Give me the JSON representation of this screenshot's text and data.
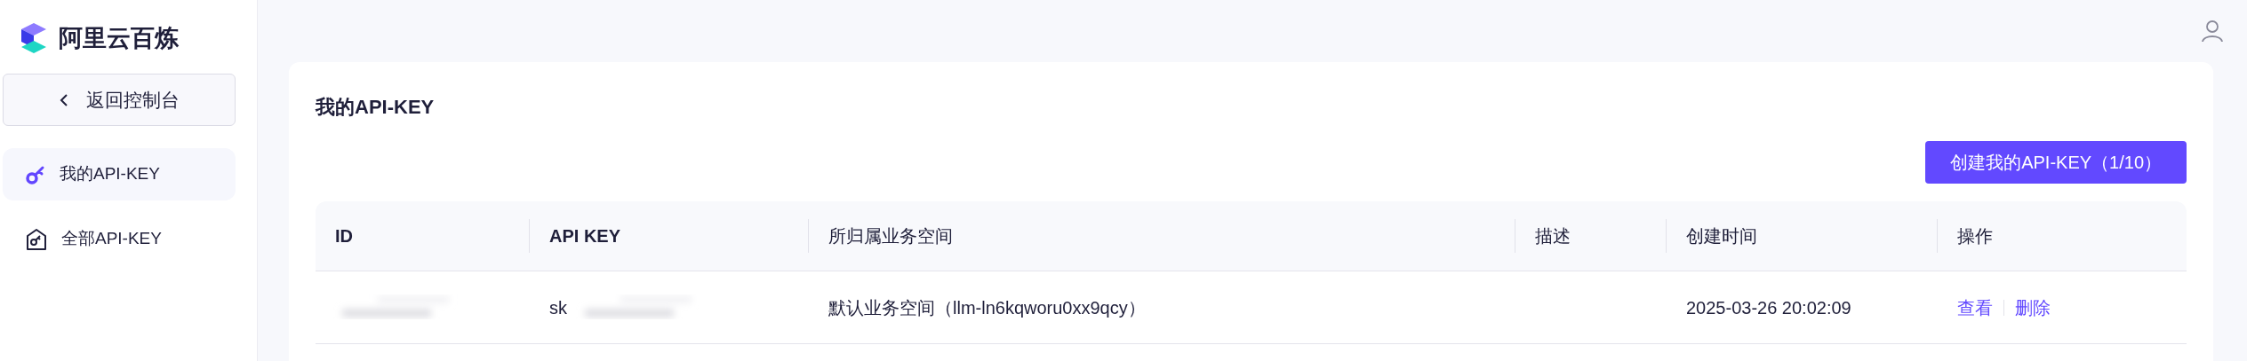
{
  "brand": {
    "name": "阿里云百炼"
  },
  "sidebar": {
    "back_button": "返回控制台",
    "items": [
      {
        "label": "我的API-KEY",
        "selected": true,
        "kind": "key"
      },
      {
        "label": "全部API-KEY",
        "selected": false,
        "kind": "house-key"
      }
    ]
  },
  "page": {
    "title": "我的API-KEY",
    "create_button": "创建我的API-KEY（1/10）"
  },
  "table": {
    "columns": [
      "ID",
      "API KEY",
      "所归属业务空间",
      "描述",
      "创建时间",
      "操作"
    ],
    "rows": [
      {
        "id_redacted": true,
        "api_key": "sk",
        "key_redacted": true,
        "workspace": "默认业务空间（llm-ln6kqworu0xx9qcy）",
        "created": "2025-03-26 20:02:09",
        "actions": [
          "查看",
          "删除"
        ]
      }
    ]
  }
}
